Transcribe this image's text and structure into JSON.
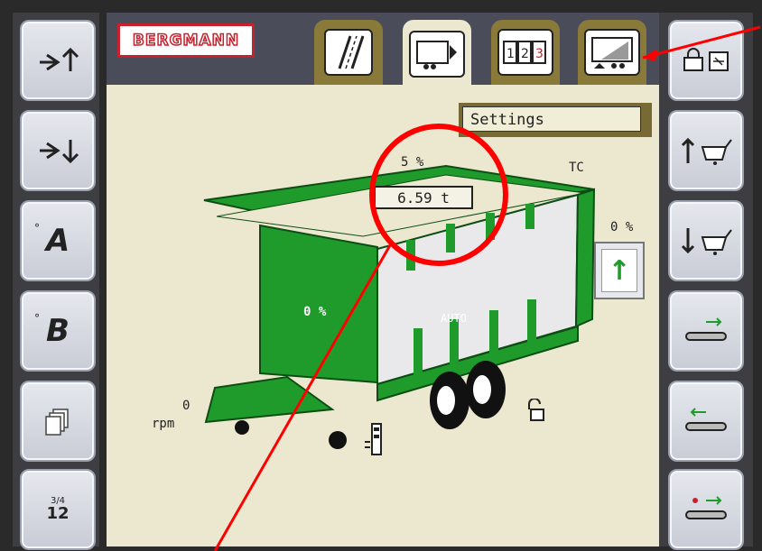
{
  "brand": {
    "name": "BERGMANN"
  },
  "tabs": [
    {
      "name": "road-mode",
      "icon": "road-icon"
    },
    {
      "name": "trailer-unload",
      "icon": "trailer-unload-icon",
      "active": true
    },
    {
      "name": "counter",
      "icon": "counter-icon",
      "text": "12"
    },
    {
      "name": "load-view",
      "icon": "load-view-icon"
    }
  ],
  "settings": {
    "label": "Settings"
  },
  "readouts": {
    "top_percent": "5 %",
    "weight": "6.59 t",
    "tc": "TC",
    "right_percent": "0 %",
    "body_percent": "0 %",
    "mode": "AUTO",
    "rpm_value": "0",
    "rpm_unit": "rpm"
  },
  "left_buttons": [
    {
      "name": "drawbar-up",
      "icon": "drawbar-up-icon"
    },
    {
      "name": "drawbar-down",
      "icon": "drawbar-down-icon"
    },
    {
      "name": "preset-a",
      "label": "A"
    },
    {
      "name": "preset-b",
      "label": "B"
    },
    {
      "name": "pages",
      "icon": "pages-icon"
    },
    {
      "name": "counter",
      "label": "12",
      "sup": "3/4"
    }
  ],
  "right_buttons": [
    {
      "name": "lock",
      "icon": "lock-icon"
    },
    {
      "name": "tailgate-up",
      "icon": "tailgate-up-icon"
    },
    {
      "name": "tailgate-down",
      "icon": "tailgate-down-icon"
    },
    {
      "name": "floor-forward",
      "icon": "floor-forward-icon"
    },
    {
      "name": "floor-backward",
      "icon": "floor-backward-icon"
    },
    {
      "name": "floor-auto",
      "icon": "floor-auto-icon"
    }
  ],
  "colors": {
    "accent": "#1f9b2b",
    "brand": "#c8202c",
    "annotation": "#ff0000"
  }
}
